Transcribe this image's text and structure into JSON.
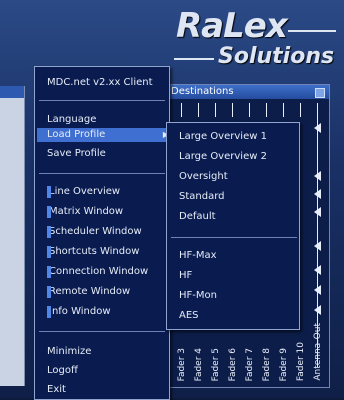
{
  "logo": {
    "line1": "RaLex",
    "line2": "Solutions"
  },
  "destinations": {
    "title": "Destinations",
    "faders": [
      "Fader 3",
      "Fader 4",
      "Fader 5",
      "Fader 6",
      "Fader 7",
      "Fader 8",
      "Fader 9",
      "Fader 10"
    ],
    "antenna": "Antenna-Out"
  },
  "menu": {
    "header": "MDC.net v2.xx Client",
    "group1": [
      "Language",
      "Load Profile",
      "Save Profile"
    ],
    "windows": [
      "Line Overview",
      "Matrix Window",
      "Scheduler Window",
      "Shortcuts Window",
      "Connection Window",
      "Remote Window",
      "Info Window"
    ],
    "group3": [
      "Minimize",
      "Logoff",
      "Exit"
    ]
  },
  "submenu": {
    "profiles": [
      "Large Overview 1",
      "Large Overview 2",
      "Oversight",
      "Standard",
      "Default"
    ],
    "presets": [
      "HF-Max",
      "HF",
      "HF-Mon",
      "AES"
    ]
  },
  "colors": {
    "menu_bg": "#0a1c4f",
    "highlight": "#3f6fd0",
    "accent_bar": "#4f86e8"
  }
}
